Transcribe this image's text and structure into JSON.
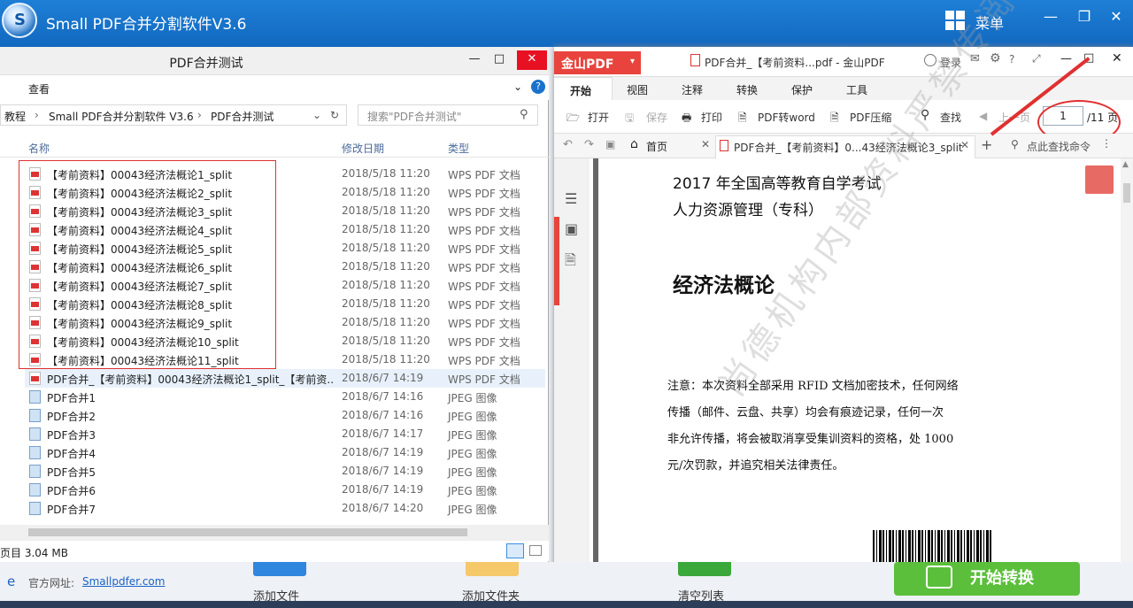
{
  "app": {
    "title": "Small PDF合并分割软件V3.6",
    "logo_glyph": "S",
    "menu_label": "菜单"
  },
  "explorer": {
    "title": "PDF合并测试",
    "ribbon_view": "查看",
    "breadcrumb": [
      "教程",
      "Small PDF合并分割软件 V3.6",
      "PDF合并测试"
    ],
    "search_placeholder": "搜索\"PDF合并测试\"",
    "columns": {
      "name": "名称",
      "date": "修改日期",
      "type": "类型"
    },
    "files": [
      {
        "name": "【考前资料】00043经济法概论1_split",
        "date": "2018/5/18 11:20",
        "type": "WPS PDF 文档",
        "kind": "pdf"
      },
      {
        "name": "【考前资料】00043经济法概论2_split",
        "date": "2018/5/18 11:20",
        "type": "WPS PDF 文档",
        "kind": "pdf"
      },
      {
        "name": "【考前资料】00043经济法概论3_split",
        "date": "2018/5/18 11:20",
        "type": "WPS PDF 文档",
        "kind": "pdf"
      },
      {
        "name": "【考前资料】00043经济法概论4_split",
        "date": "2018/5/18 11:20",
        "type": "WPS PDF 文档",
        "kind": "pdf"
      },
      {
        "name": "【考前资料】00043经济法概论5_split",
        "date": "2018/5/18 11:20",
        "type": "WPS PDF 文档",
        "kind": "pdf"
      },
      {
        "name": "【考前资料】00043经济法概论6_split",
        "date": "2018/5/18 11:20",
        "type": "WPS PDF 文档",
        "kind": "pdf"
      },
      {
        "name": "【考前资料】00043经济法概论7_split",
        "date": "2018/5/18 11:20",
        "type": "WPS PDF 文档",
        "kind": "pdf"
      },
      {
        "name": "【考前资料】00043经济法概论8_split",
        "date": "2018/5/18 11:20",
        "type": "WPS PDF 文档",
        "kind": "pdf"
      },
      {
        "name": "【考前资料】00043经济法概论9_split",
        "date": "2018/5/18 11:20",
        "type": "WPS PDF 文档",
        "kind": "pdf"
      },
      {
        "name": "【考前资料】00043经济法概论10_split",
        "date": "2018/5/18 11:20",
        "type": "WPS PDF 文档",
        "kind": "pdf"
      },
      {
        "name": "【考前资料】00043经济法概论11_split",
        "date": "2018/5/18 11:20",
        "type": "WPS PDF 文档",
        "kind": "pdf"
      },
      {
        "name": "PDF合并_【考前资料】00043经济法概论1_split_【考前资...",
        "date": "2018/6/7 14:19",
        "type": "WPS PDF 文档",
        "kind": "pdf"
      },
      {
        "name": "PDF合并1",
        "date": "2018/6/7 14:16",
        "type": "JPEG 图像",
        "kind": "jpg"
      },
      {
        "name": "PDF合并2",
        "date": "2018/6/7 14:16",
        "type": "JPEG 图像",
        "kind": "jpg"
      },
      {
        "name": "PDF合并3",
        "date": "2018/6/7 14:17",
        "type": "JPEG 图像",
        "kind": "jpg"
      },
      {
        "name": "PDF合并4",
        "date": "2018/6/7 14:19",
        "type": "JPEG 图像",
        "kind": "jpg"
      },
      {
        "name": "PDF合并5",
        "date": "2018/6/7 14:19",
        "type": "JPEG 图像",
        "kind": "jpg"
      },
      {
        "name": "PDF合并6",
        "date": "2018/6/7 14:19",
        "type": "JPEG 图像",
        "kind": "jpg"
      },
      {
        "name": "PDF合并7",
        "date": "2018/6/7 14:20",
        "type": "JPEG 图像",
        "kind": "jpg"
      }
    ],
    "status": "页目 3.04 MB"
  },
  "wps": {
    "logo": "金山PDF",
    "doc_title": "PDF合并_【考前资料...pdf - 金山PDF",
    "login": "登录",
    "tabs": [
      "开始",
      "视图",
      "注释",
      "转换",
      "保护",
      "工具"
    ],
    "tools": {
      "open": "打开",
      "save": "保存",
      "print": "打印",
      "toword": "PDF转word",
      "compress": "PDF压缩",
      "find": "查找",
      "prev": "上一页"
    },
    "page_current": "1",
    "page_total": "/11 页",
    "home_tab": "首页",
    "doc_tab": "PDF合并_【考前资料】0...43经济法概论3_split",
    "search_hint": "点此查找命令",
    "page": {
      "line1": "2017 年全国高等教育自学考试",
      "line2": "人力资源管理（专科）",
      "heading": "经济法概论",
      "notice": [
        "注意：本次资料全部采用 RFID 文档加密技术，任何网络",
        "传播（邮件、云盘、共享）均会有痕迹记录，任何一次",
        "非允许传播，将会被取消享受集训资料的资格，处 1000",
        "元/次罚款，并追究相关法律责任。"
      ],
      "watermark": "尚德机构内部资料严禁传阅"
    }
  },
  "bottom": {
    "website_label": "官方网址:",
    "website": "Smallpdfer.com",
    "add_file": "添加文件",
    "add_folder": "添加文件夹",
    "clear": "清空列表",
    "convert": "开始转换"
  },
  "colors": {
    "accent": "#1a72cc",
    "wps_red": "#e8433d",
    "highlight_red": "#e03030",
    "convert_green": "#5bbf3b"
  }
}
